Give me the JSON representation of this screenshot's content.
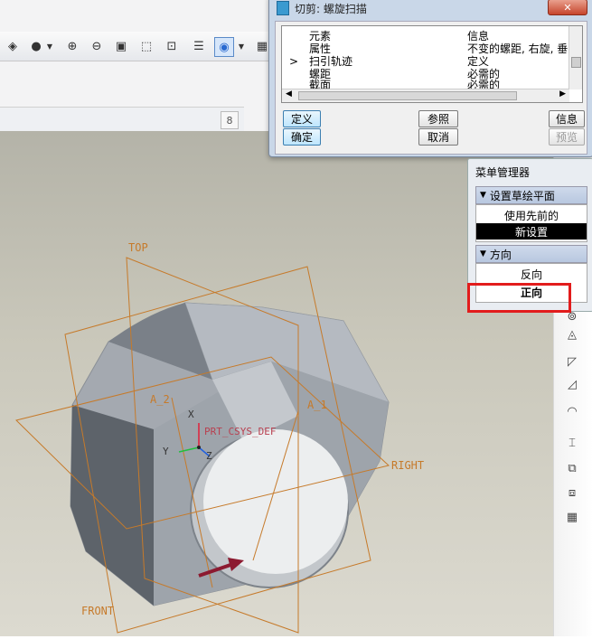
{
  "dialog": {
    "title": "切剪: 螺旋扫描",
    "columns": {
      "element": "元素",
      "info": "信息"
    },
    "rows": [
      {
        "marker": "",
        "element": "属性",
        "info": "不变的螺距, 右旋, 垂"
      },
      {
        "marker": ">",
        "element": "扫引轨迹",
        "info": "定义"
      },
      {
        "marker": "",
        "element": "螺距",
        "info": "必需的"
      },
      {
        "marker": "",
        "element": "截面",
        "info": "必需的"
      }
    ],
    "buttons": {
      "define": "定义",
      "ok": "确定",
      "refs": "参照",
      "cancel": "取消",
      "info": "信息",
      "preview": "预览"
    }
  },
  "menu_manager": {
    "title": "菜单管理器",
    "section1": {
      "label": "设置草绘平面",
      "items": [
        "使用先前的",
        "新设置"
      ],
      "selected": "新设置"
    },
    "section2": {
      "label": "方向",
      "items": [
        "反向",
        "正向"
      ],
      "highlighted": "正向"
    }
  },
  "model_labels": {
    "top": "TOP",
    "right": "RIGHT",
    "front": "FRONT",
    "a2": "A_2",
    "a1": "A_1",
    "csys": "PRT_CSYS_DEF",
    "x": "X",
    "y": "Y",
    "z": "Z"
  },
  "colors": {
    "datum": "#c67a2a",
    "highlight": "#e21c1c",
    "arrow": "#8c1a30"
  }
}
